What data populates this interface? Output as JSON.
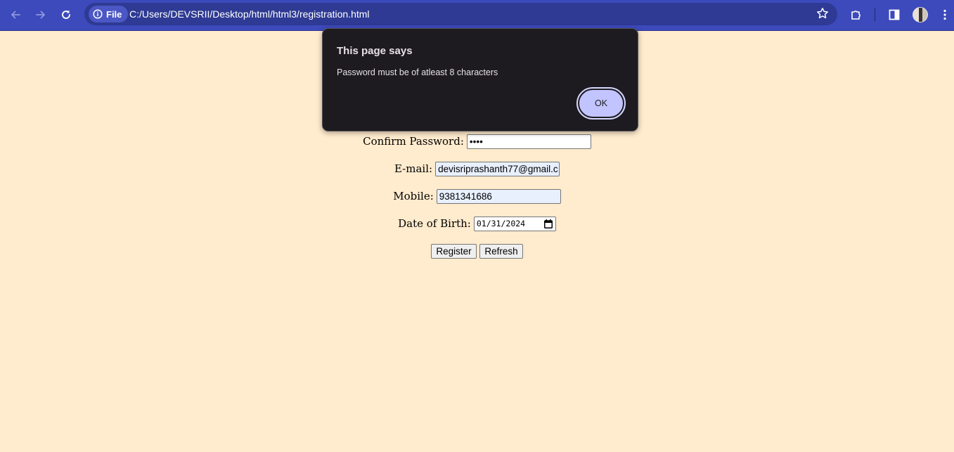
{
  "browser": {
    "url": "C:/Users/DEVSRII/Desktop/html/html3/registration.html",
    "site_chip": "File",
    "colors": {
      "toolbar": "#3d4abc",
      "omnibox": "#2e3a93"
    }
  },
  "icons": {
    "back": "arrow-left-icon",
    "forward": "arrow-right-icon",
    "reload": "reload-icon",
    "info": "info-icon",
    "bookmark": "star-icon",
    "extensions": "puzzle-icon",
    "side_panel": "side-panel-icon",
    "profile": "avatar",
    "menu": "kebab-menu-icon",
    "calendar": "calendar-icon"
  },
  "form": {
    "confirm_password": {
      "label": "Confirm Password:",
      "value": "••••"
    },
    "email": {
      "label": "E-mail:",
      "value": "devisriprashanth77@gmail.c"
    },
    "mobile": {
      "label": "Mobile:",
      "value": "9381341686"
    },
    "dob": {
      "label": "Date of Birth:",
      "value": "01/31/2024"
    },
    "register_label": "Register",
    "refresh_label": "Refresh",
    "colors": {
      "background": "#ffebcd",
      "autofill": "#e8f0fe"
    }
  },
  "dialog": {
    "title": "This page says",
    "message": "Password must be of atleast 8 characters",
    "ok_label": "OK",
    "colors": {
      "background": "#1d1b20",
      "ok_button": "#c2c4ff"
    }
  }
}
